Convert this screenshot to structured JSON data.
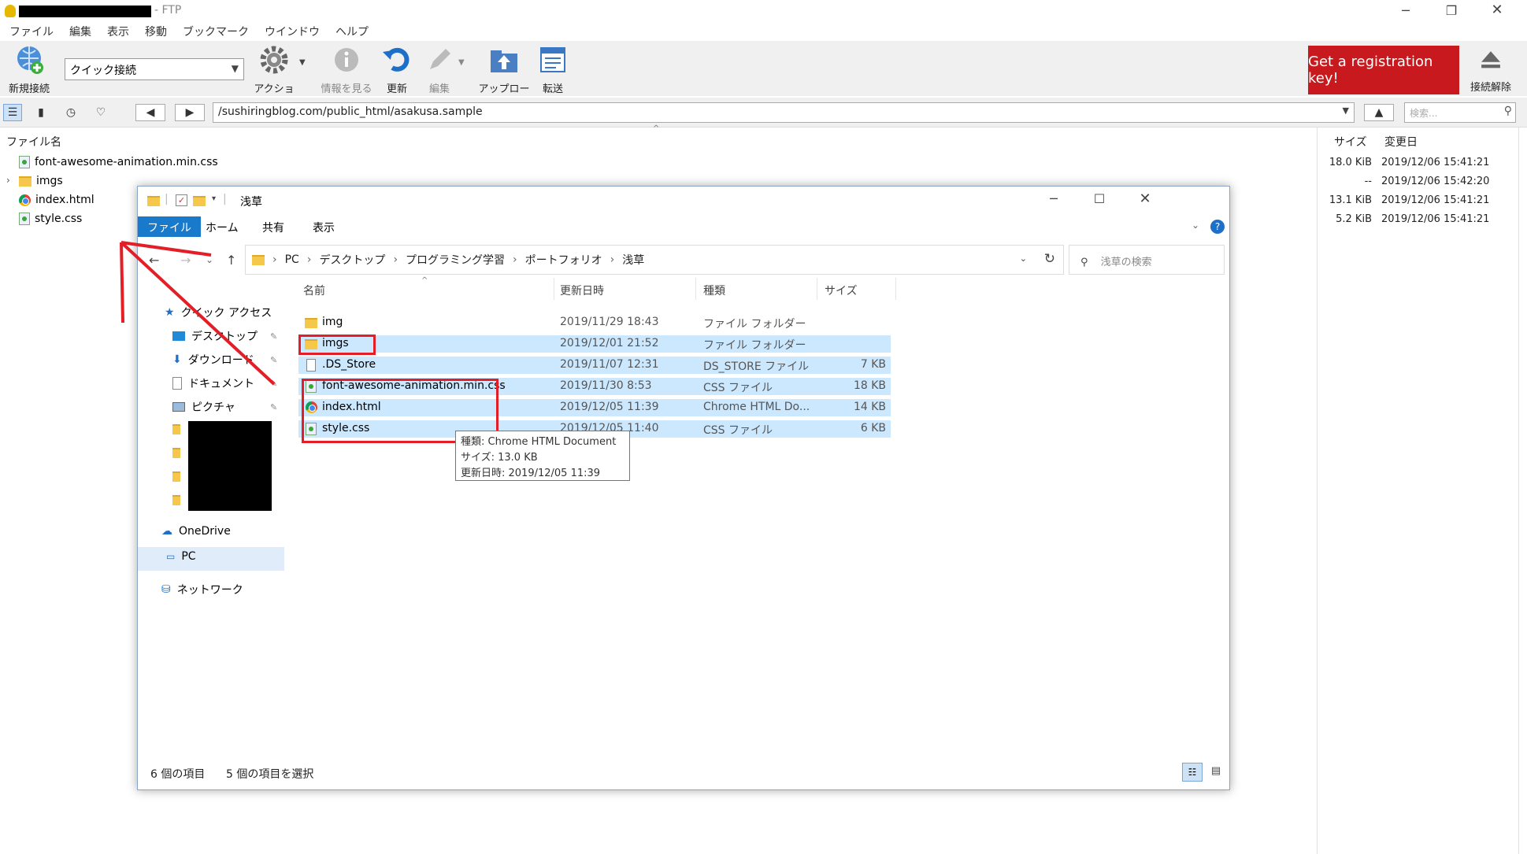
{
  "ftp": {
    "app_suffix": "- FTP",
    "menu": [
      "ファイル",
      "編集",
      "表示",
      "移動",
      "ブックマーク",
      "ウインドウ",
      "ヘルプ"
    ],
    "toolbar": {
      "new_connection": "新規接続",
      "quick_connect": "クイック接続",
      "action": "アクション",
      "info": "情報を見る",
      "refresh": "更新",
      "edit": "編集",
      "upload": "アップロード",
      "transfer": "転送",
      "register": "Get a registration key!",
      "disconnect": "接続解除"
    },
    "path": "/sushiringblog.com/public_html/asakusa.sample",
    "search_placeholder": "検索...",
    "columns": {
      "name": "ファイル名",
      "size": "サイズ",
      "modified": "変更日"
    },
    "files": [
      {
        "name": "font-awesome-animation.min.css",
        "icon": "css-file-icon",
        "size": "18.0 KiB",
        "modified": "2019/12/06 15:41:21"
      },
      {
        "name": "imgs",
        "icon": "folder-icon",
        "size": "--",
        "modified": "2019/12/06 15:42:20"
      },
      {
        "name": "index.html",
        "icon": "chrome-icon",
        "size": "13.1 KiB",
        "modified": "2019/12/06 15:41:21"
      },
      {
        "name": "style.css",
        "icon": "css-file-icon",
        "size": "5.2 KiB",
        "modified": "2019/12/06 15:41:21"
      }
    ]
  },
  "explorer": {
    "title": "浅草",
    "ribbon": [
      "ファイル",
      "ホーム",
      "共有",
      "表示"
    ],
    "breadcrumb": [
      "PC",
      "デスクトップ",
      "プログラミング学習",
      "ポートフォリオ",
      "浅草"
    ],
    "search_placeholder": "浅草の検索",
    "nav": {
      "quick_access": "クイック アクセス",
      "desktop": "デスクトップ",
      "downloads": "ダウンロード",
      "documents": "ドキュメント",
      "pictures": "ピクチャ",
      "onedrive": "OneDrive",
      "pc": "PC",
      "network": "ネットワーク"
    },
    "columns": {
      "name": "名前",
      "modified": "更新日時",
      "type": "種類",
      "size": "サイズ"
    },
    "files": [
      {
        "name": "img",
        "modified": "2019/11/29 18:43",
        "type": "ファイル フォルダー",
        "size": ""
      },
      {
        "name": "imgs",
        "modified": "2019/12/01 21:52",
        "type": "ファイル フォルダー",
        "size": ""
      },
      {
        "name": ".DS_Store",
        "modified": "2019/11/07 12:31",
        "type": "DS_STORE ファイル",
        "size": "7 KB"
      },
      {
        "name": "font-awesome-animation.min.css",
        "modified": "2019/11/30 8:53",
        "type": "CSS ファイル",
        "size": "18 KB"
      },
      {
        "name": "index.html",
        "modified": "2019/12/05 11:39",
        "type": "Chrome HTML Do...",
        "size": "14 KB"
      },
      {
        "name": "style.css",
        "modified": "2019/12/05 11:40",
        "type": "CSS ファイル",
        "size": "6 KB"
      }
    ],
    "tooltip": {
      "type": "種類: Chrome HTML Document",
      "size": "サイズ: 13.0 KB",
      "modified": "更新日時: 2019/12/05 11:39"
    },
    "status": {
      "count": "6 個の項目",
      "selected": "5 個の項目を選択"
    }
  }
}
